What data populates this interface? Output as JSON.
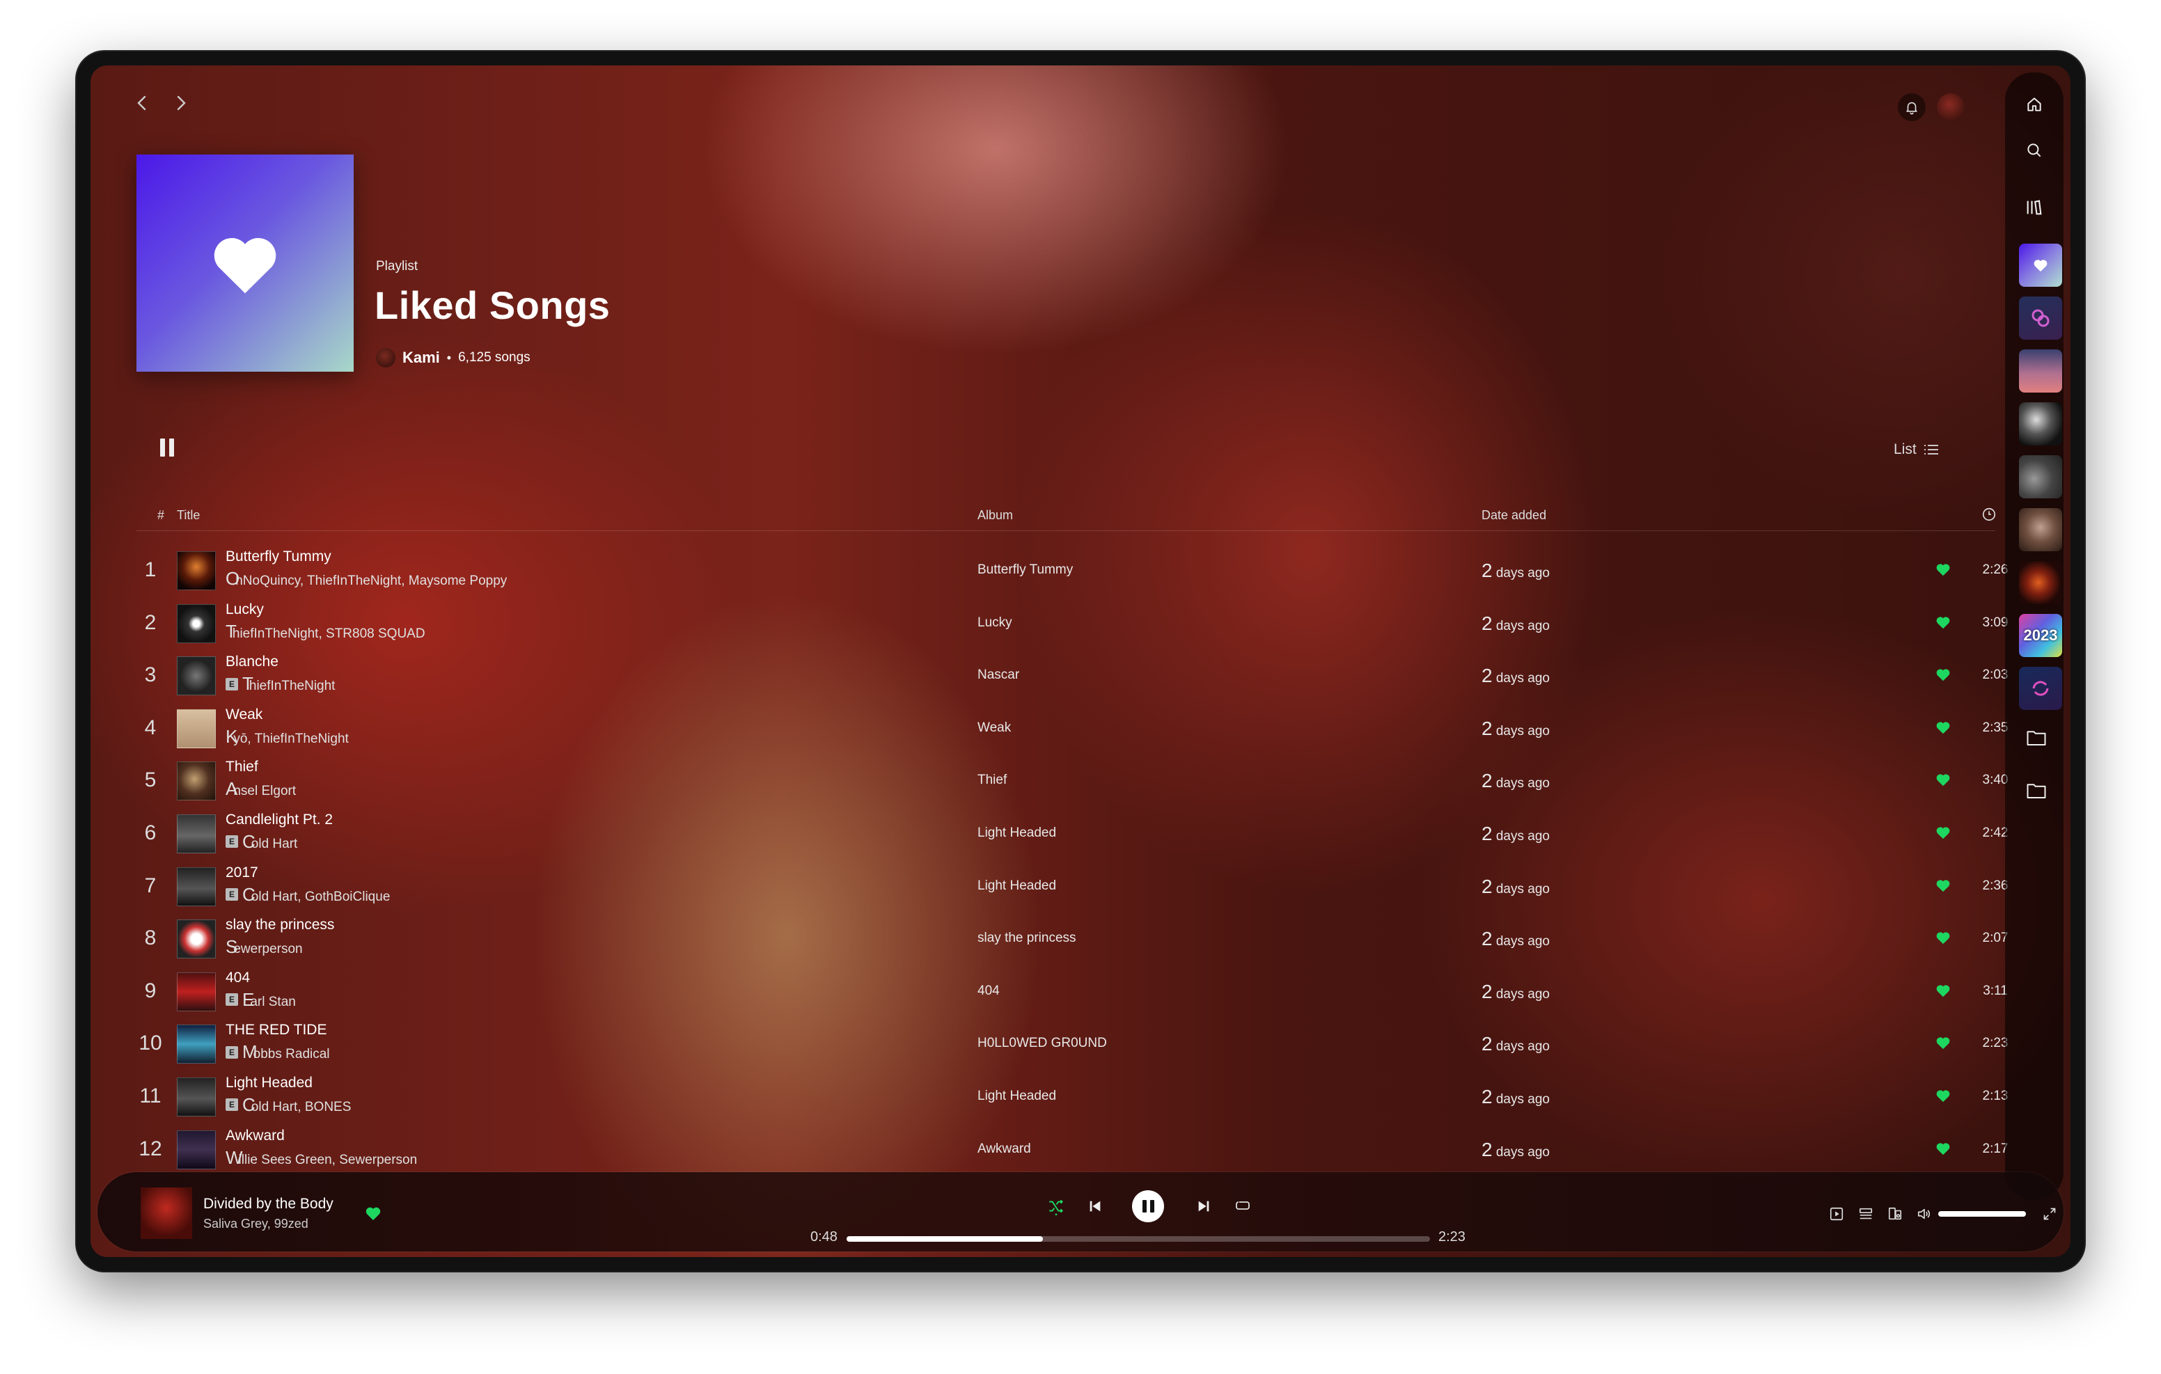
{
  "colors": {
    "accent_green": "#1ed760",
    "text": "#ffffff",
    "muted": "#dddddd"
  },
  "playlist": {
    "type": "Playlist",
    "title": "Liked Songs",
    "owner": "Kami",
    "separator": "•",
    "song_count": "6,125 songs"
  },
  "view_toggle": {
    "label": "List"
  },
  "table": {
    "headers": {
      "num": "#",
      "title": "Title",
      "album": "Album",
      "date": "Date added"
    },
    "rows": [
      {
        "num": "1",
        "title": "Butterfly Tummy",
        "artists_first": "O",
        "artists_rest": "hNoQuincy, ThiefInTheNight, Maysome Poppy",
        "explicit": false,
        "album": "Butterfly Tummy",
        "date_first": "2",
        "date_rest": " days ago",
        "duration": "2:26"
      },
      {
        "num": "2",
        "title": "Lucky",
        "artists_first": "T",
        "artists_rest": "hiefInTheNight, STR808 SQUAD",
        "explicit": false,
        "album": "Lucky",
        "date_first": "2",
        "date_rest": " days ago",
        "duration": "3:09"
      },
      {
        "num": "3",
        "title": "Blanche",
        "artists_first": "T",
        "artists_rest": "hiefInTheNight",
        "explicit": true,
        "album": "Nascar",
        "date_first": "2",
        "date_rest": " days ago",
        "duration": "2:03"
      },
      {
        "num": "4",
        "title": "Weak",
        "artists_first": "K",
        "artists_rest": "yō, ThiefInTheNight",
        "explicit": false,
        "album": "Weak",
        "date_first": "2",
        "date_rest": " days ago",
        "duration": "2:35"
      },
      {
        "num": "5",
        "title": "Thief",
        "artists_first": "A",
        "artists_rest": "nsel Elgort",
        "explicit": false,
        "album": "Thief",
        "date_first": "2",
        "date_rest": " days ago",
        "duration": "3:40"
      },
      {
        "num": "6",
        "title": "Candlelight Pt. 2",
        "artists_first": "C",
        "artists_rest": "old Hart",
        "explicit": true,
        "album": "Light Headed",
        "date_first": "2",
        "date_rest": " days ago",
        "duration": "2:42"
      },
      {
        "num": "7",
        "title": "2017",
        "artists_first": "C",
        "artists_rest": "old Hart, GothBoiClique",
        "explicit": true,
        "album": "Light Headed",
        "date_first": "2",
        "date_rest": " days ago",
        "duration": "2:36"
      },
      {
        "num": "8",
        "title": "slay the princess",
        "artists_first": "S",
        "artists_rest": "ewerperson",
        "explicit": false,
        "album": "slay the princess",
        "date_first": "2",
        "date_rest": " days ago",
        "duration": "2:07"
      },
      {
        "num": "9",
        "title": "404",
        "artists_first": "E",
        "artists_rest": "arl Stan",
        "explicit": true,
        "album": "404",
        "date_first": "2",
        "date_rest": " days ago",
        "duration": "3:11"
      },
      {
        "num": "10",
        "title": "THE RED TIDE",
        "artists_first": "M",
        "artists_rest": "obbs Radical",
        "explicit": true,
        "album": "H0LL0WED GR0UND",
        "date_first": "2",
        "date_rest": " days ago",
        "duration": "2:23"
      },
      {
        "num": "11",
        "title": "Light Headed",
        "artists_first": "C",
        "artists_rest": "old Hart, BONES",
        "explicit": true,
        "album": "Light Headed",
        "date_first": "2",
        "date_rest": " days ago",
        "duration": "2:13"
      },
      {
        "num": "12",
        "title": "Awkward",
        "artists_first": "W",
        "artists_rest": "illie Sees Green, Sewerperson",
        "explicit": false,
        "album": "Awkward",
        "date_first": "2",
        "date_rest": " days ago",
        "duration": "2:17"
      }
    ]
  },
  "explicit_label": "E",
  "sidebar": {
    "year_tile_label": "2023"
  },
  "player": {
    "title": "Divided by the Body",
    "artists": "Saliva Grey, 99zed",
    "time_elapsed": "0:48",
    "time_total": "2:23",
    "progress": 0.336,
    "volume": 1.0
  }
}
